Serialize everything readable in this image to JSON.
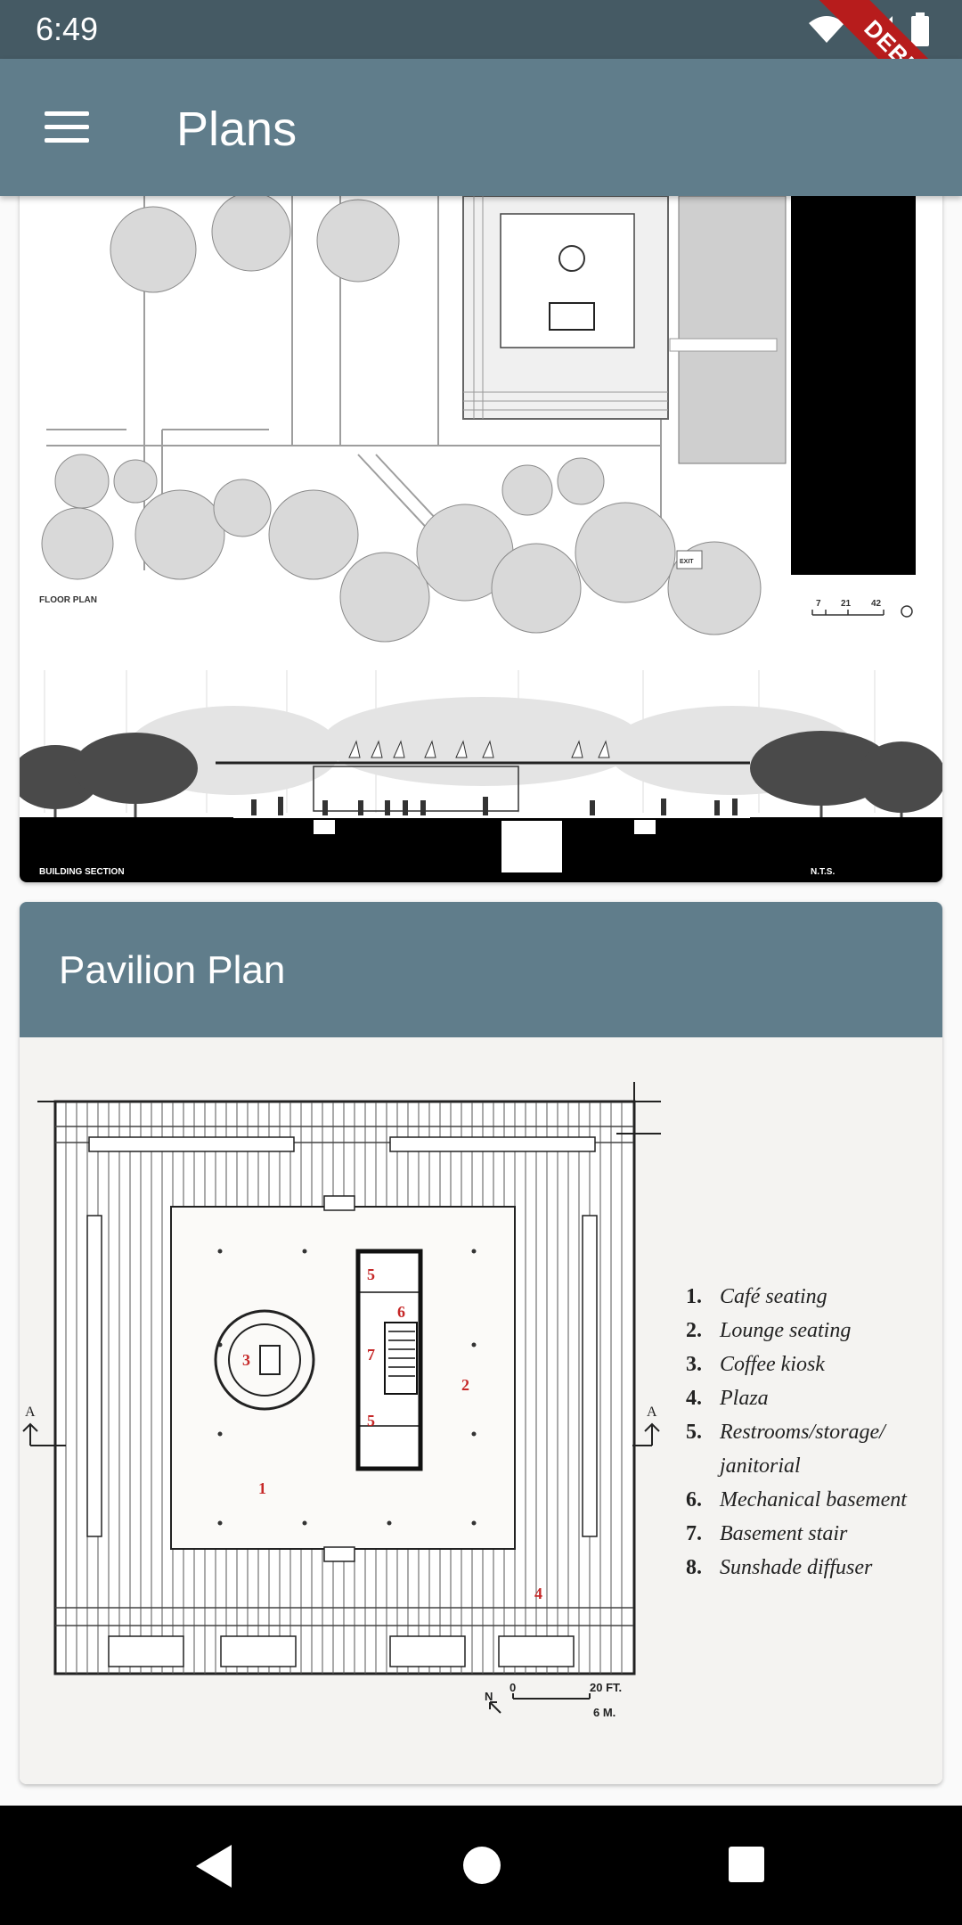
{
  "status_bar": {
    "time": "6:49",
    "debug_label": "DEBUG",
    "icons": [
      "wifi-icon",
      "signal-icon",
      "battery-icon"
    ]
  },
  "app_bar": {
    "title": "Plans",
    "menu_icon": "menu-icon"
  },
  "cards": [
    {
      "image_labels": {
        "floor_plan": "FLOOR PLAN",
        "building_section": "BUILDING SECTION",
        "scale_note": "N.T.S.",
        "scale_ticks": [
          "7",
          "21",
          "42"
        ],
        "section_box": "EXIT"
      }
    },
    {
      "header": "Pavilion Plan",
      "legend": [
        {
          "num": "1.",
          "text": "Café seating"
        },
        {
          "num": "2.",
          "text": "Lounge seating"
        },
        {
          "num": "3.",
          "text": "Coffee kiosk"
        },
        {
          "num": "4.",
          "text": "Plaza"
        },
        {
          "num": "5.",
          "text": "Restrooms/storage/"
        },
        {
          "num": "",
          "text": "janitorial"
        },
        {
          "num": "6.",
          "text": "Mechanical basement"
        },
        {
          "num": "7.",
          "text": "Basement stair"
        },
        {
          "num": "8.",
          "text": "Sunshade diffuser"
        }
      ],
      "plan_marks": {
        "m1": "1",
        "m2": "2",
        "m3": "3",
        "m4": "4",
        "m5a": "5",
        "m5b": "5",
        "m6": "6",
        "m7": "7",
        "section_a": "A",
        "north": "N",
        "scale_zero": "0",
        "scale_ft": "20 FT.",
        "scale_m": "6 M."
      }
    }
  ],
  "nav_bar": {
    "back_icon": "back-icon",
    "home_icon": "home-icon",
    "recents_icon": "recents-icon"
  },
  "colors": {
    "app_bar": "#607d8b",
    "status_bar": "#455a64",
    "debug": "#b71c1c",
    "plan_numbers": "#c62828"
  }
}
